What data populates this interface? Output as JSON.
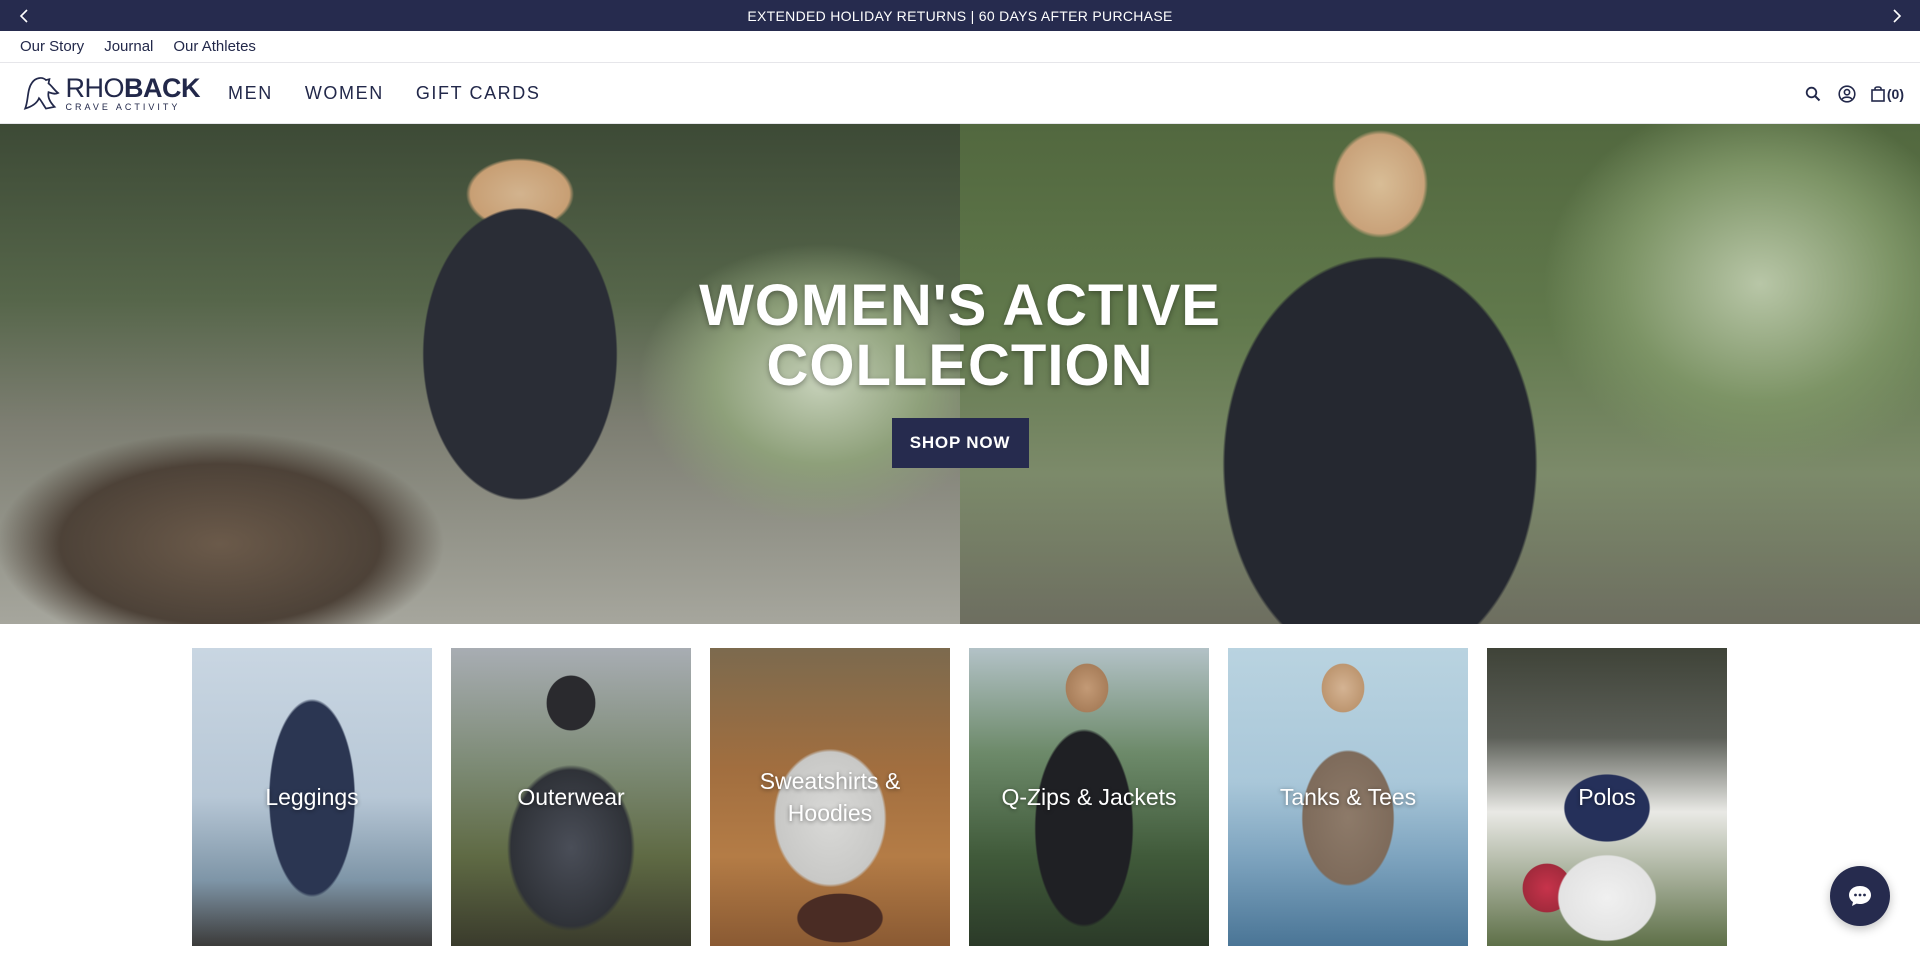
{
  "announcement": {
    "message": "EXTENDED HOLIDAY RETURNS | 60 DAYS AFTER PURCHASE"
  },
  "utility_nav": {
    "links": [
      "Our Story",
      "Journal",
      "Our Athletes"
    ]
  },
  "header": {
    "logo": {
      "brand_light": "RHO",
      "brand_bold": "BACK",
      "tagline": "CRAVE ACTIVITY"
    },
    "nav": [
      "MEN",
      "WOMEN",
      "GIFT CARDS"
    ],
    "cart_count": "(0)",
    "icons": [
      "search-icon",
      "account-icon",
      "cart-icon"
    ]
  },
  "hero": {
    "title": "WOMEN'S ACTIVE COLLECTION",
    "cta": "SHOP NOW"
  },
  "categories": [
    {
      "label": "Leggings"
    },
    {
      "label": "Outerwear"
    },
    {
      "label": "Sweatshirts & Hoodies"
    },
    {
      "label": "Q-Zips & Jackets"
    },
    {
      "label": "Tanks & Tees"
    },
    {
      "label": "Polos"
    }
  ],
  "colors": {
    "navy": "#262b4e",
    "text": "#22284a",
    "white": "#ffffff"
  }
}
